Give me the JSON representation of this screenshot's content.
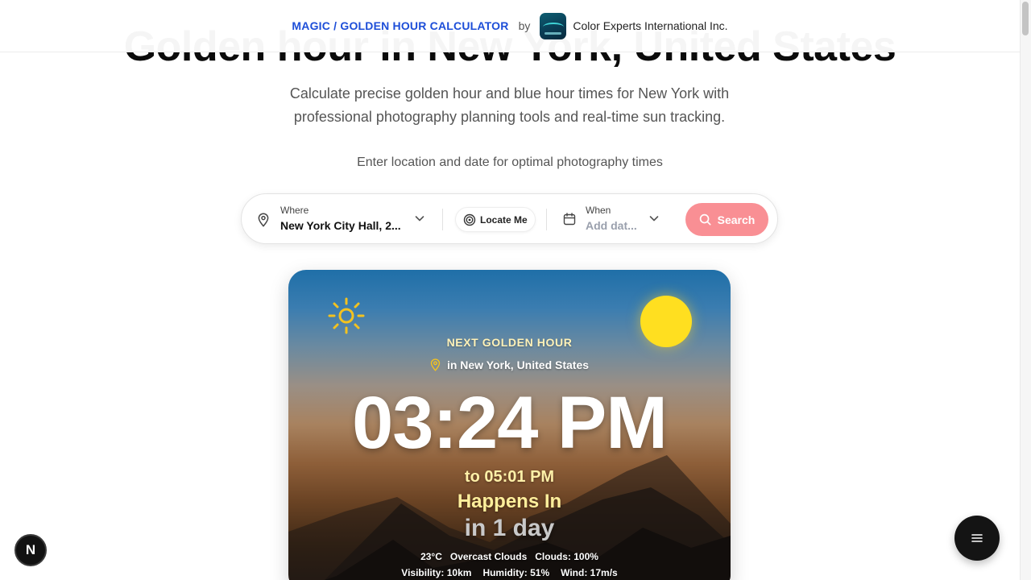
{
  "header": {
    "app_link": "MAGIC / GOLDEN HOUR CALCULATOR",
    "by": "by",
    "company": "Color Experts International Inc."
  },
  "hero": {
    "title": "Golden hour in New York, United States",
    "subtitle": "Calculate precise golden hour and blue hour times for New York with professional photography planning tools and real-time sun tracking.",
    "hint": "Enter location and date for optimal photography times"
  },
  "search": {
    "where_label": "Where",
    "where_value": "New York City Hall, 2...",
    "locate_label": "Locate Me",
    "when_label": "When",
    "when_placeholder": "Add dat...",
    "search_label": "Search"
  },
  "card": {
    "kicker": "NEXT GOLDEN HOUR",
    "location": "in New York, United States",
    "time": "03:24 PM",
    "to": "to 05:01 PM",
    "happens": "Happens In",
    "countdown": "in 1 day",
    "weather": {
      "temp": "23°C",
      "condition": "Overcast Clouds",
      "clouds": "Clouds: 100%",
      "visibility": "Visibility: 10km",
      "humidity": "Humidity: 51%",
      "wind": "Wind: 17m/s"
    }
  },
  "badge_letter": "N",
  "colors": {
    "brand_link": "#1d4ed8",
    "search_button": "#f98f94",
    "sun": "#ffdf20",
    "accent_text": "#fff2b8"
  },
  "icons": {
    "where": "map-pin-icon",
    "locate": "target-icon",
    "when": "calendar-icon",
    "search": "search-icon",
    "card_sun": "sun-icon",
    "card_location": "map-pin-icon",
    "menu": "menu-icon"
  }
}
